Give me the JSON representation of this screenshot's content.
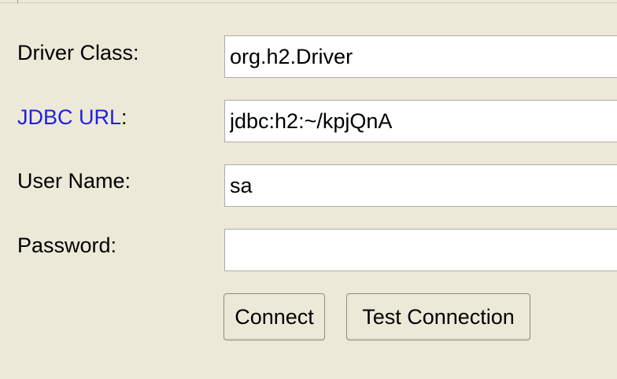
{
  "form": {
    "driver_class": {
      "label": "Driver Class:",
      "value": "org.h2.Driver"
    },
    "jdbc_url": {
      "link_text": "JDBC URL",
      "label_suffix": ":",
      "value": "jdbc:h2:~/kpjQnA",
      "link_color": "#1f1fde"
    },
    "user_name": {
      "label": "User Name:",
      "value": "sa"
    },
    "password": {
      "label": "Password:",
      "value": ""
    }
  },
  "buttons": {
    "connect": "Connect",
    "test_connection": "Test Connection"
  },
  "colors": {
    "background": "#ece9d8",
    "field_background": "#ffffff",
    "field_border": "#b0ada2",
    "button_border": "#8e8b80"
  }
}
